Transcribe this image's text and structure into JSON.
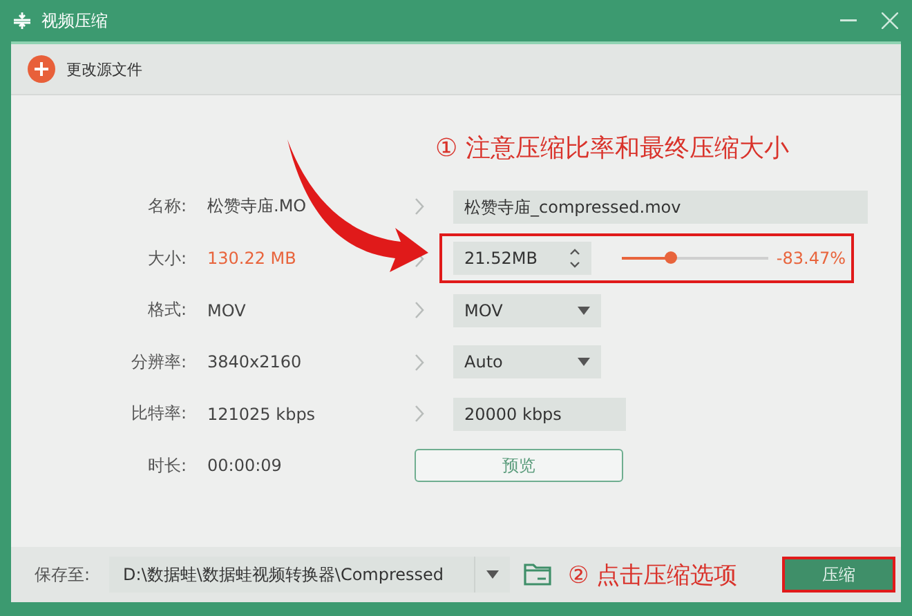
{
  "window": {
    "title": "视频压缩"
  },
  "toolbar": {
    "change_source": "更改源文件"
  },
  "size_note": "① 注意压缩比率和最终压缩大小",
  "rows": [
    {
      "kind": "text",
      "label": "名称:",
      "source": "松赞寺庙.MO",
      "value": "松赞寺庙_compressed.mov",
      "highlighted": false
    },
    {
      "kind": "size",
      "label": "大小:",
      "source": "130.22 MB",
      "value": "21.52MB",
      "level": 0.34,
      "reading": "-83.47%",
      "highlighted": true
    },
    {
      "kind": "dropdown",
      "label": "格式:",
      "source": "MOV",
      "value": "MOV",
      "highlighted": false
    },
    {
      "kind": "dropdown",
      "label": "分辨率:",
      "source": "3840x2160",
      "value": "Auto",
      "highlighted": false
    },
    {
      "kind": "short",
      "label": "比特率:",
      "source": "121025 kbps",
      "value": "20000 kbps",
      "highlighted": false
    },
    {
      "kind": "button",
      "label": "时长:",
      "source": "00:00:09",
      "value": "预览",
      "highlighted": false
    }
  ],
  "footer": {
    "save_label": "保存至:",
    "path": "D:\\数据蛙\\数据蛙视频转换器\\Compressed",
    "compress_note": "② 点击压缩选项",
    "compress_button": "压缩",
    "compress_highlighted": true
  }
}
